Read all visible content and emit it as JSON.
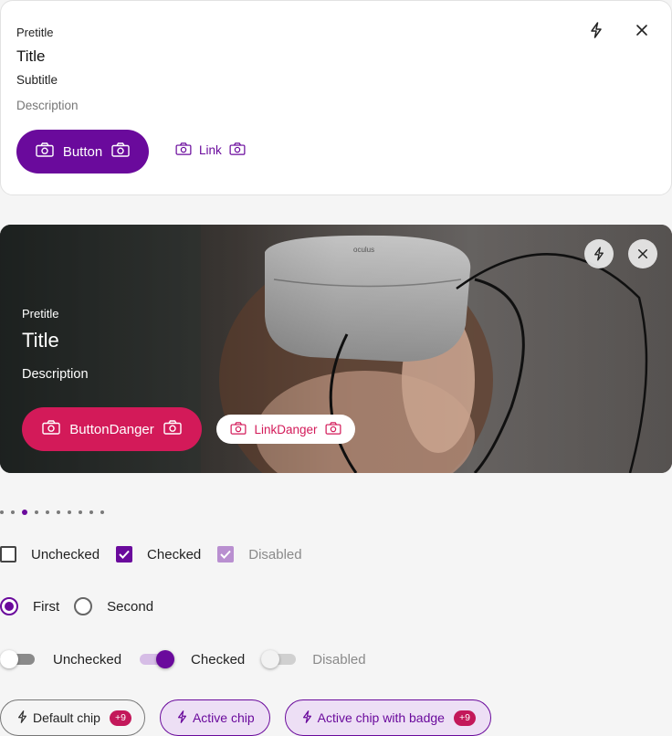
{
  "card_light": {
    "pretitle": "Pretitle",
    "title": "Title",
    "subtitle": "Subtitle",
    "description": "Description",
    "button_label": "Button",
    "link_label": "Link"
  },
  "card_image": {
    "pretitle": "Pretitle",
    "title": "Title",
    "description": "Description",
    "button_label": "ButtonDanger",
    "link_label": "LinkDanger",
    "image_brand_text": "oculus"
  },
  "pagination": {
    "total": 10,
    "active_index": 2
  },
  "checkboxes": [
    {
      "label": "Unchecked",
      "state": "unchecked"
    },
    {
      "label": "Checked",
      "state": "checked"
    },
    {
      "label": "Disabled",
      "state": "disabled-checked"
    }
  ],
  "radios": [
    {
      "label": "First",
      "checked": true
    },
    {
      "label": "Second",
      "checked": false
    }
  ],
  "toggles": [
    {
      "label": "Unchecked",
      "state": "off"
    },
    {
      "label": "Checked",
      "state": "on"
    },
    {
      "label": "Disabled",
      "state": "disabled"
    }
  ],
  "chips": [
    {
      "label": "Default chip",
      "badge": "+9",
      "active": false
    },
    {
      "label": "Active chip",
      "active": true
    },
    {
      "label": "Active chip with badge",
      "badge": "+9",
      "active": true
    }
  ],
  "icons": {
    "card_actions": [
      "lightning-icon",
      "close-icon"
    ],
    "button_icons": "camera-icon",
    "chip_icon": "lightning-icon"
  },
  "colors": {
    "primary": "#6a0a9c",
    "danger": "#d31a59",
    "badge": "#c3185a",
    "background": "#f5f5f5"
  }
}
